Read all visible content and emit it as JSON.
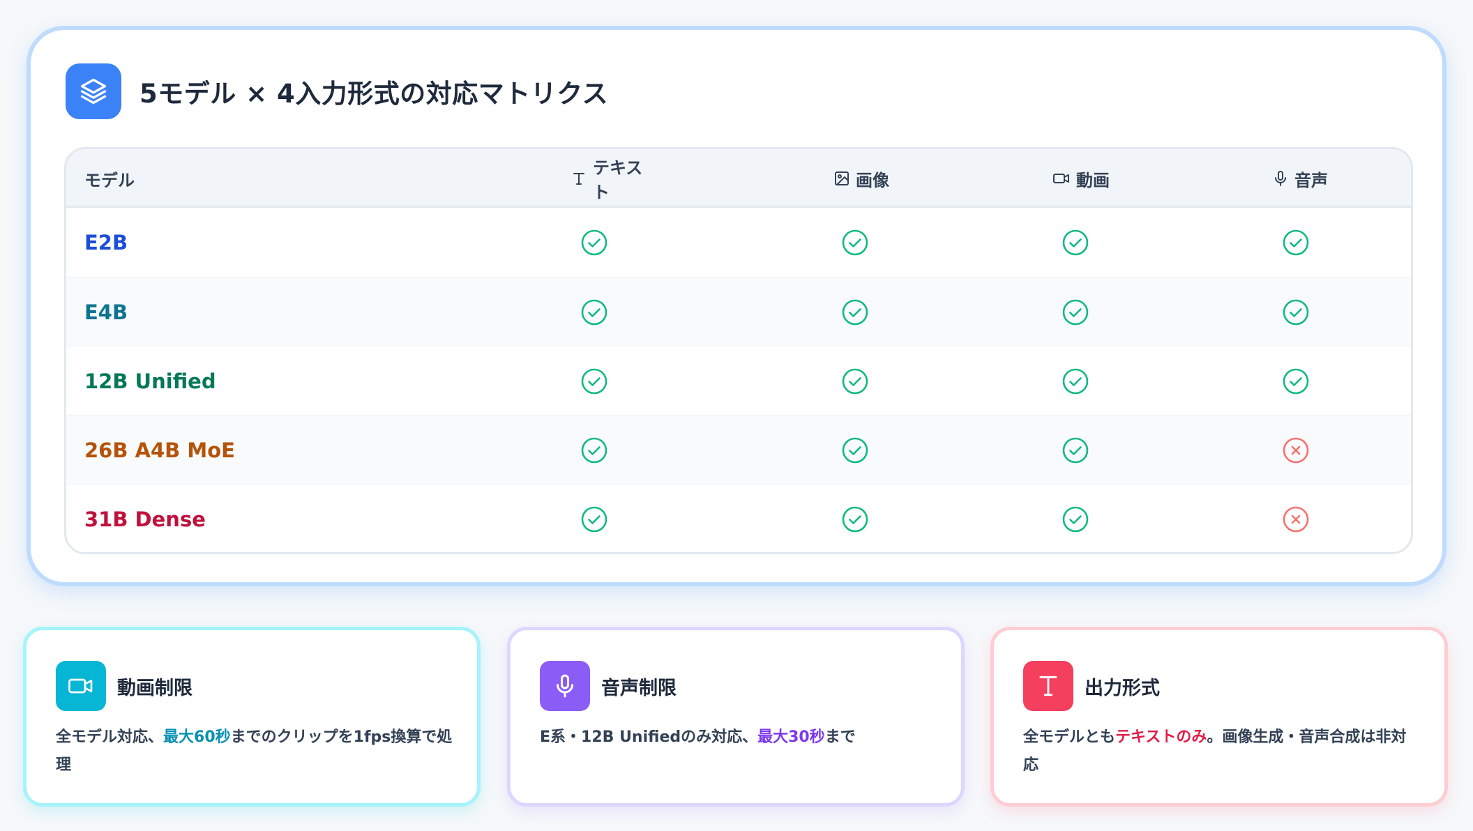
{
  "title": "5モデル × 4入力形式の対応マトリクス",
  "table": {
    "headers": {
      "model": "モデル",
      "text": "テキスト",
      "image": "画像",
      "video": "動画",
      "audio": "音声"
    },
    "rows": [
      {
        "model": "E2B",
        "color": "#1d4ed8",
        "support": [
          true,
          true,
          true,
          true
        ]
      },
      {
        "model": "E4B",
        "color": "#0e7490",
        "support": [
          true,
          true,
          true,
          true
        ]
      },
      {
        "model": "12B Unified",
        "color": "#047857",
        "support": [
          true,
          true,
          true,
          true
        ]
      },
      {
        "model": "26B A4B MoE",
        "color": "#b45309",
        "support": [
          true,
          true,
          true,
          false
        ]
      },
      {
        "model": "31B Dense",
        "color": "#be123c",
        "support": [
          true,
          true,
          true,
          false
        ]
      }
    ],
    "supported_color": "#10b981",
    "unsupported_color": "#f87171"
  },
  "cards": {
    "video": {
      "title": "動画制限",
      "pre": "全モデル対応、",
      "highlight": "最大60秒",
      "post": "までのクリップを1fps換算で処理",
      "accent": "#06b6d4",
      "highlight_color": "#0891b2"
    },
    "audio": {
      "title": "音声制限",
      "pre": "E系・12B Unifiedのみ対応、",
      "highlight": "最大30秒",
      "post": "まで",
      "accent": "#8b5cf6",
      "highlight_color": "#7c3aed"
    },
    "output": {
      "title": "出力形式",
      "pre": "全モデルとも",
      "highlight": "テキストのみ",
      "post": "。画像生成・音声合成は非対応",
      "accent": "#f43f5e",
      "highlight_color": "#e11d48"
    }
  }
}
